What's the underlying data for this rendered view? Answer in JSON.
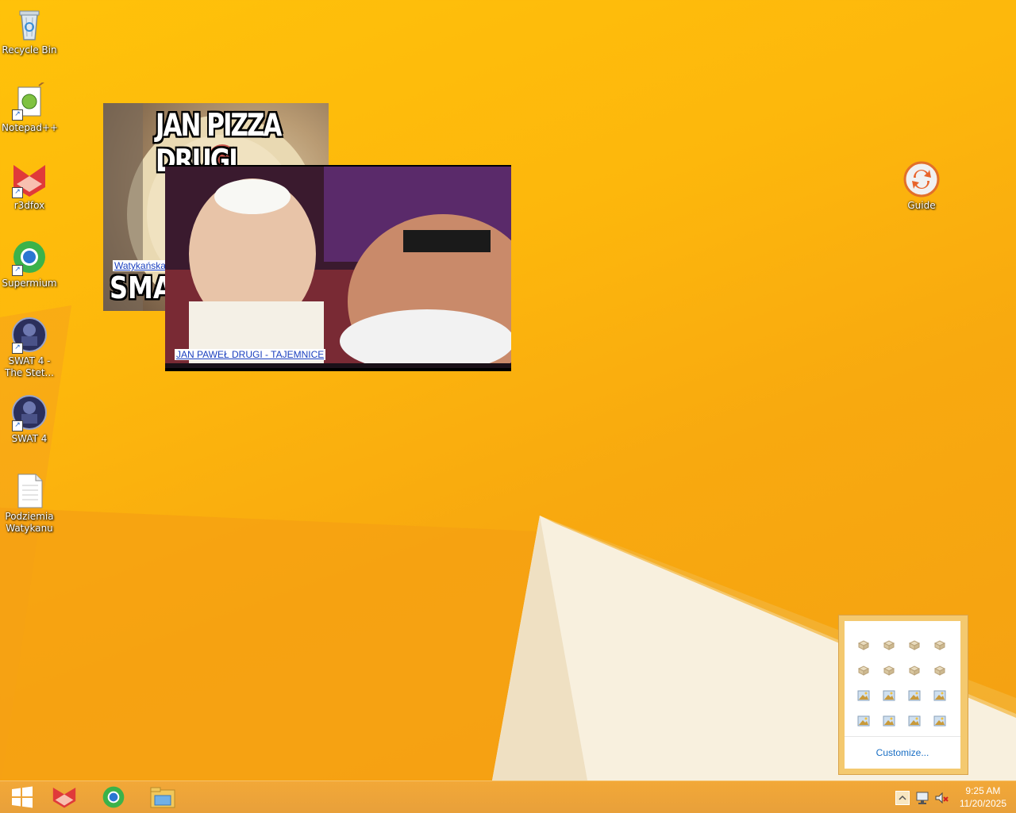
{
  "desktop": {
    "icons": [
      {
        "label": "Recycle Bin",
        "icon": "recycle-bin-icon"
      },
      {
        "label": "Notepad++",
        "icon": "notepad-plus-plus-icon"
      },
      {
        "label": "r3dfox",
        "icon": "r3dfox-icon"
      },
      {
        "label": "Supermium",
        "icon": "supermium-icon"
      },
      {
        "label": "SWAT 4 - The Stet...",
        "icon": "swat4-stetchkov-icon"
      },
      {
        "label": "SWAT 4",
        "icon": "swat4-icon"
      },
      {
        "label": "Podziemia Watykanu",
        "icon": "text-document-icon"
      },
      {
        "label": "Guide",
        "icon": "guide-sync-icon"
      }
    ]
  },
  "thumbnails": [
    {
      "title": "JAN PIZZA DRUGI",
      "overlay_text": "SMAKO",
      "caption": "Watykańska"
    },
    {
      "caption": "JAN PAWEŁ DRUGI - TAJEMNICE"
    }
  ],
  "tray_popup": {
    "customize_label": "Customize..."
  },
  "taskbar": {
    "pinned": [
      "start-button",
      "r3dfox-taskbar",
      "supermium-taskbar",
      "file-explorer-taskbar"
    ],
    "time": "9:25 AM",
    "date": "11/20/2025"
  }
}
